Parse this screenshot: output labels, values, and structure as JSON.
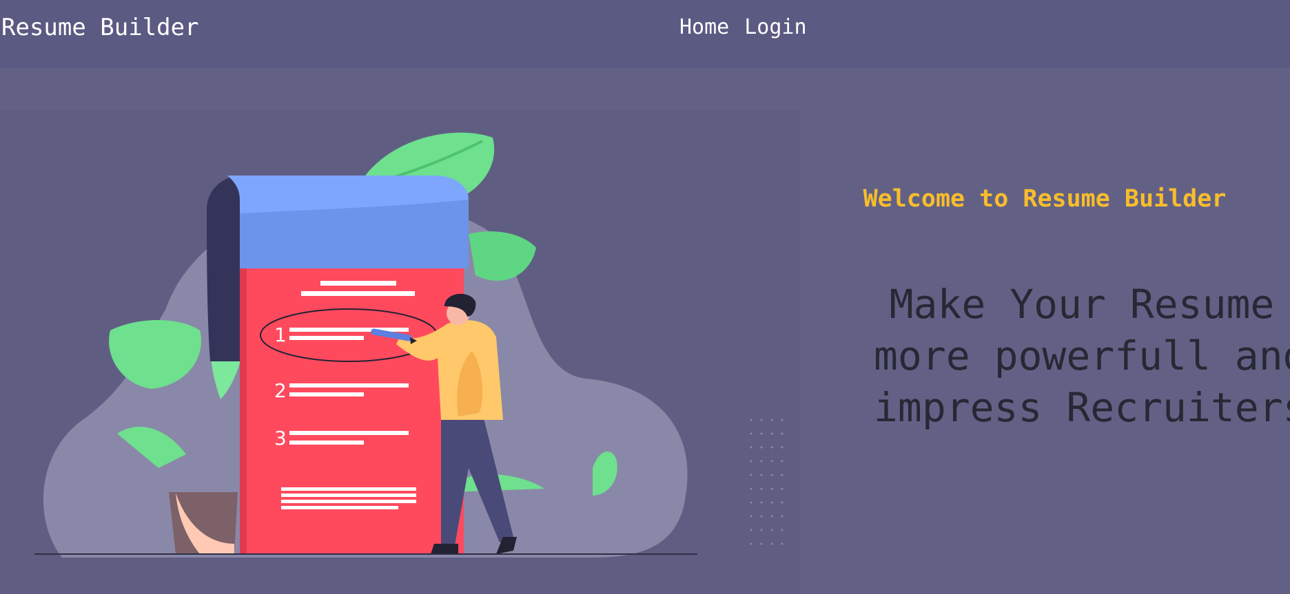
{
  "navbar": {
    "brand": "Resume Builder",
    "links": [
      "Home",
      "Login"
    ]
  },
  "hero": {
    "welcome": "Welcome to Resume Builder",
    "tagline_lines": [
      "Make Your Resume",
      "more powerfull and",
      "impress Recruiters"
    ],
    "list_numbers": [
      "1",
      "2",
      "3"
    ]
  },
  "colors": {
    "navbar_bg": "#5b5a82",
    "page_bg": "#626185",
    "welcome_text": "#f9bd2b",
    "tagline_text": "#272835",
    "resume_paper": "#ff4a5e",
    "scroll_top": "#7ea6ff",
    "leaves": "#6ee08e",
    "person_shirt": "#ffc86a"
  },
  "icons": [
    "resume-scroll-illustration",
    "person-writing-illustration",
    "plant-leaves-illustration"
  ]
}
